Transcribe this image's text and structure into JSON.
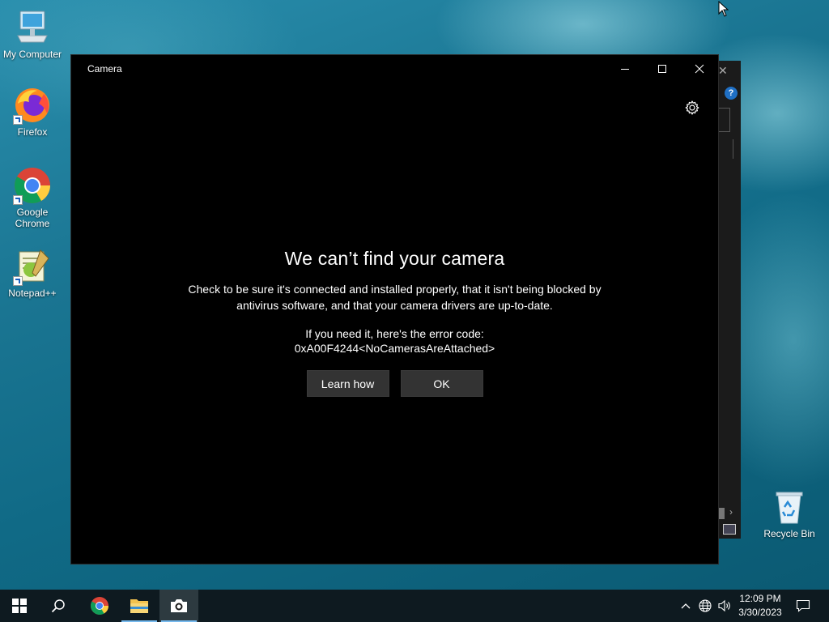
{
  "desktop": {
    "icons": [
      {
        "label": "My Computer"
      },
      {
        "label": "Firefox"
      },
      {
        "label": "Google Chrome"
      },
      {
        "label": "Notepad++"
      },
      {
        "label": "Recycle Bin"
      }
    ]
  },
  "camera_window": {
    "title": "Camera",
    "heading": "We can’t find your camera",
    "message": "Check to be sure it's connected and installed properly, that it isn't being blocked by antivirus software, and that your camera drivers are up-to-date.",
    "error_intro": "If you need it, here's the error code:",
    "error_code": "0xA00F4244<NoCamerasAreAttached>",
    "learn_how_label": "Learn how",
    "ok_label": "OK"
  },
  "taskbar": {
    "clock_time": "12:09 PM",
    "clock_date": "3/30/2023"
  },
  "colors": {
    "accent": "#76b9ed",
    "window_bg": "#000000",
    "button_bg": "#333333",
    "taskbar_bg": "#0e1a20"
  }
}
